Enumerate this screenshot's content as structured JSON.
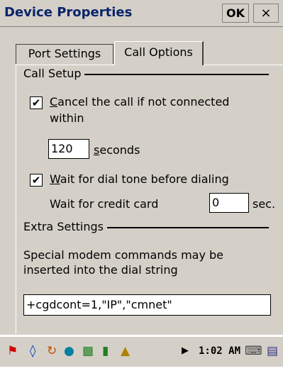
{
  "window": {
    "title": "Device Properties",
    "ok_label": "OK",
    "close_label": "×"
  },
  "tabs": [
    {
      "label": "Port Settings",
      "active": false
    },
    {
      "label": "Call Options",
      "active": true
    }
  ],
  "call_setup": {
    "group_label": "Call Setup",
    "cancel_call": {
      "checked": true,
      "mark": "✔",
      "label_accel": "C",
      "label_rest": "ancel the call if not connected",
      "label_line2": "within"
    },
    "seconds_value": "120",
    "seconds_accel": "s",
    "seconds_rest": "econds",
    "wait_dial_tone": {
      "checked": true,
      "mark": "✔",
      "label_accel": "W",
      "label_rest": "ait for dial tone before dialing"
    },
    "credit_card_label": "Wait for credit card",
    "credit_card_value": "0",
    "credit_card_unit": "sec."
  },
  "extra_settings": {
    "group_label": "Extra Settings",
    "description_line1": "Special modem commands may be",
    "description_line2": "inserted into the dial string",
    "dial_string_value": "+cgdcont=1,\"IP\",\"cmnet\""
  },
  "taskbar": {
    "time": "1:02 AM",
    "icons": [
      "start-flag-icon",
      "bluetooth-icon",
      "activesync-icon",
      "network-icon",
      "signal-icon",
      "signal-bars-icon",
      "connection-icon",
      "arrow-icon",
      "keyboard-icon",
      "network-adapter-icon"
    ]
  }
}
